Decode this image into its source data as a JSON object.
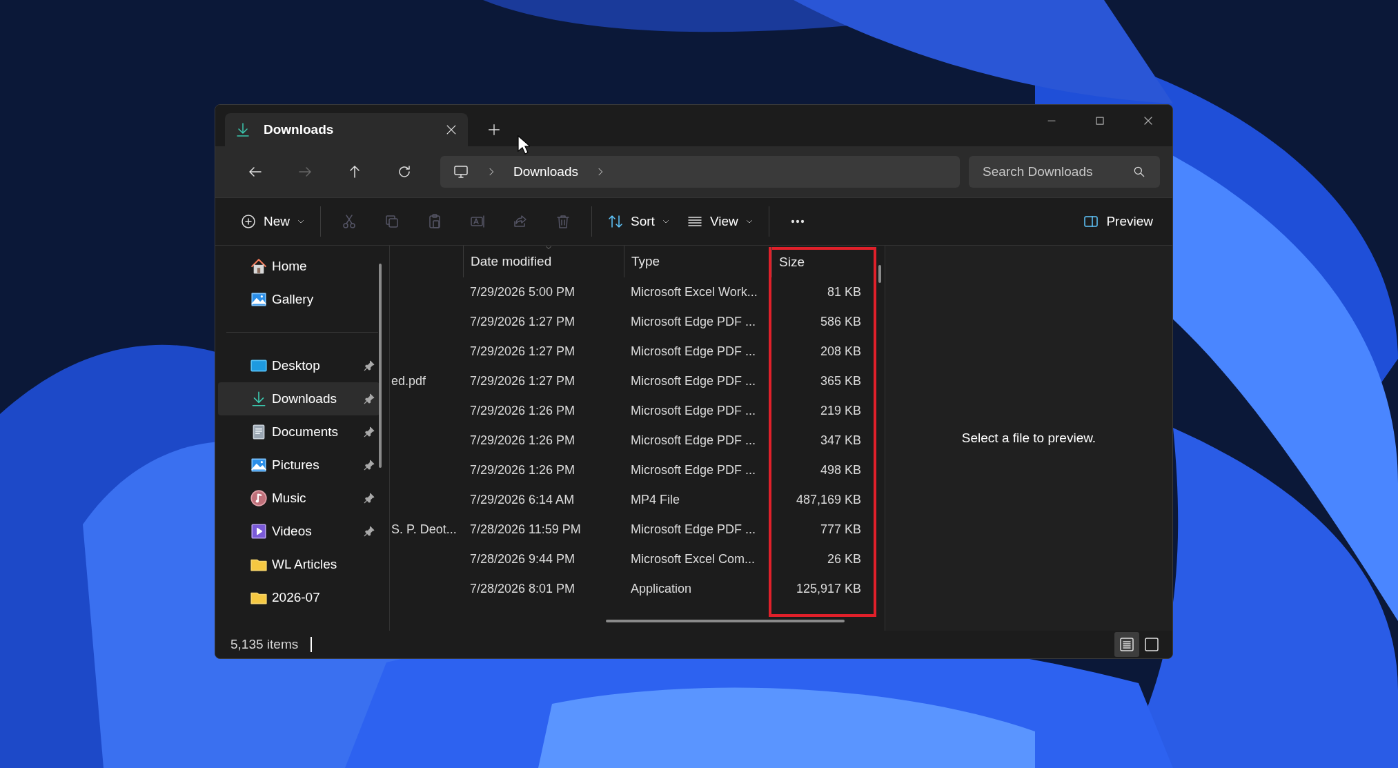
{
  "tabs": [
    {
      "label": "Downloads",
      "kind": "download",
      "selected": true
    }
  ],
  "nav_buttons": [
    {
      "kind": "back",
      "disabled": false
    },
    {
      "kind": "forward",
      "disabled": true
    },
    {
      "kind": "up",
      "disabled": false
    },
    {
      "kind": "refresh",
      "disabled": false
    }
  ],
  "address": {
    "segments": [
      "Downloads"
    ]
  },
  "search": {
    "placeholder": "Search Downloads"
  },
  "toolbar": [
    {
      "kind": "new",
      "label": "New",
      "disabled": false
    },
    {
      "kind": "cut",
      "disabled": true
    },
    {
      "kind": "copy",
      "disabled": true
    },
    {
      "kind": "paste",
      "disabled": true
    },
    {
      "kind": "rename",
      "disabled": true
    },
    {
      "kind": "share",
      "disabled": true
    },
    {
      "kind": "delete",
      "disabled": true
    },
    {
      "kind": "sort",
      "label": "Sort",
      "disabled": false
    },
    {
      "kind": "view",
      "label": "View",
      "disabled": false
    },
    {
      "kind": "more",
      "disabled": false
    }
  ],
  "preview_button": {
    "label": "Preview"
  },
  "sidebar": {
    "groups": [
      [
        {
          "label": "Home",
          "kind": "home",
          "pinned": false,
          "selected": false
        },
        {
          "label": "Gallery",
          "kind": "gallery",
          "pinned": false,
          "selected": false
        }
      ],
      [
        {
          "label": "Desktop",
          "kind": "desktop",
          "pinned": true,
          "selected": false
        },
        {
          "label": "Downloads",
          "kind": "download",
          "pinned": true,
          "selected": true
        },
        {
          "label": "Documents",
          "kind": "documents",
          "pinned": true,
          "selected": false
        },
        {
          "label": "Pictures",
          "kind": "gallery",
          "pinned": true,
          "selected": false
        },
        {
          "label": "Music",
          "kind": "music",
          "pinned": true,
          "selected": false
        },
        {
          "label": "Videos",
          "kind": "videos",
          "pinned": true,
          "selected": false
        },
        {
          "label": "WL Articles",
          "kind": "folder",
          "pinned": false,
          "selected": false
        },
        {
          "label": "2026-07",
          "kind": "folder",
          "pinned": false,
          "selected": false
        }
      ]
    ]
  },
  "table": {
    "columns": [
      {
        "label": "Date modified",
        "sorted": true,
        "highlighted": false
      },
      {
        "label": "Type",
        "sorted": false,
        "highlighted": false
      },
      {
        "label": "Size",
        "sorted": false,
        "highlighted": true
      }
    ],
    "rows": [
      {
        "date": "7/29/2026 5:00 PM",
        "type": "Microsoft Excel Work...",
        "size": "81 KB"
      },
      {
        "date": "7/29/2026 1:27 PM",
        "type": "Microsoft Edge PDF ...",
        "size": "586 KB"
      },
      {
        "date": "7/29/2026 1:27 PM",
        "type": "Microsoft Edge PDF ...",
        "size": "208 KB"
      },
      {
        "column_1": "ed.pdf",
        "date": "7/29/2026 1:27 PM",
        "type": "Microsoft Edge PDF ...",
        "size": "365 KB"
      },
      {
        "date": "7/29/2026 1:26 PM",
        "type": "Microsoft Edge PDF ...",
        "size": "219 KB"
      },
      {
        "date": "7/29/2026 1:26 PM",
        "type": "Microsoft Edge PDF ...",
        "size": "347 KB"
      },
      {
        "date": "7/29/2026 1:26 PM",
        "type": "Microsoft Edge PDF ...",
        "size": "498 KB"
      },
      {
        "date": "7/29/2026 6:14 AM",
        "type": "MP4 File",
        "size": "487,169 KB"
      },
      {
        "column_1": "S. P. Deot...",
        "date": "7/28/2026 11:59 PM",
        "type": "Microsoft Edge PDF ...",
        "size": "777 KB"
      },
      {
        "date": "7/28/2026 9:44 PM",
        "type": "Microsoft Excel Com...",
        "size": "26 KB"
      },
      {
        "date": "7/28/2026 8:01 PM",
        "type": "Application",
        "size": "125,917 KB"
      }
    ]
  },
  "preview_pane": {
    "message": "Select a file to preview."
  },
  "status_bar": {
    "item_count": "5,135 items",
    "view_modes": [
      {
        "kind": "details",
        "selected": true
      },
      {
        "kind": "tiles",
        "selected": false
      }
    ]
  }
}
